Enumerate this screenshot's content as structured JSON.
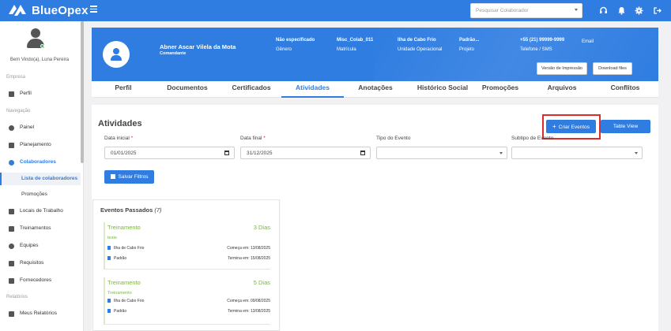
{
  "app": {
    "name": "BlueOpex"
  },
  "header": {
    "search_placeholder": "Pesquisar Colaborador"
  },
  "sidebar": {
    "welcome": "Bem Vindo(a), Luna Pereira",
    "sections": [
      "Empresa",
      "Navegação",
      "Relatórios"
    ],
    "items": [
      {
        "label": "Perfil"
      },
      {
        "label": "Painel"
      },
      {
        "label": "Planejamento"
      },
      {
        "label": "Colaboradores"
      },
      {
        "label": "Lista de colaboradores"
      },
      {
        "label": "Promoções"
      },
      {
        "label": "Locais de Trabalho"
      },
      {
        "label": "Treinamentos"
      },
      {
        "label": "Equipes"
      },
      {
        "label": "Requisitos"
      },
      {
        "label": "Fornecedores"
      },
      {
        "label": "Meus Relatórios"
      }
    ]
  },
  "profile": {
    "name": "Abner Ascar Vilela da Mota",
    "role": "Comandante",
    "gender_value": "Não especificado",
    "gender_label": "Gênero",
    "matricula_value": "Misc_Colab_011",
    "matricula_label": "Matrícula",
    "unit_value": "Ilha de Cabo Frio",
    "unit_label": "Unidade Operacional",
    "project_value": "Padrão...",
    "project_label": "Projeto",
    "phone_value": "+55 (21) 99999-9999",
    "phone_label": "Telefone / SMS",
    "email_label": "Email",
    "print_button": "Versão de Impressão",
    "download_button": "Download files"
  },
  "tabs": [
    "Perfil",
    "Documentos",
    "Certificados",
    "Atividades",
    "Anotações",
    "Histórico Social",
    "Promoções",
    "Arquivos",
    "Conflitos"
  ],
  "activities": {
    "title": "Atividades",
    "create_button": "Criar Eventos",
    "table_view_button": "Table View",
    "start_date_label": "Data inicial",
    "start_date_value": "01/01/2025",
    "end_date_label": "Data final",
    "end_date_value": "31/12/2025",
    "event_type_label": "Tipo do Evento",
    "event_subtype_label": "Subtipo de Evento",
    "save_filters_button": "Salvar Filtros"
  },
  "past_events": {
    "title": "Eventos Passados",
    "count": "(7)",
    "items": [
      {
        "type": "Treinamento",
        "duration": "3 Dias",
        "subtitle": "teste",
        "location": "Ilha de Cabo Frio",
        "project": "Padrão",
        "start": "Começa em: 13/08/2025",
        "end": "Termina em: 15/08/2025"
      },
      {
        "type": "Treinamento",
        "duration": "5 Dias",
        "subtitle": "Treinamento",
        "location": "Ilha de Cabo Frio",
        "project": "Padrão",
        "start": "Começa em: 09/08/2025",
        "end": "Termina em: 13/08/2025"
      }
    ]
  },
  "colors": {
    "primary": "#2f7de1",
    "accent_green": "#7cb342",
    "highlight_red": "#e02b2b"
  },
  "icons": [
    "menu-icon",
    "headset-icon",
    "bell-icon",
    "gear-icon",
    "logout-icon",
    "user-avatar-icon",
    "calendar-icon",
    "plus-icon",
    "save-icon"
  ]
}
